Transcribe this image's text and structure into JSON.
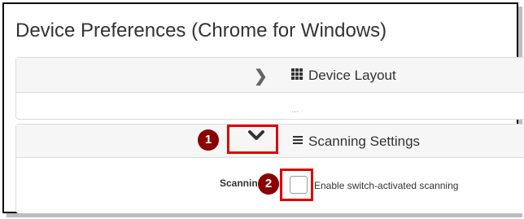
{
  "page": {
    "title": "Device Preferences (Chrome for Windows)"
  },
  "device_layout": {
    "label": "Device Layout",
    "collapsed_hint": "..."
  },
  "scanning_settings": {
    "label": "Scanning Settings",
    "row_label": "Scannin",
    "checkbox_label": "Enable switch-activated scanning",
    "checkbox_checked": false
  },
  "annotations": {
    "step1": "1",
    "step2": "2",
    "highlight_color": "#e00000",
    "badge_color": "#8b0000"
  }
}
